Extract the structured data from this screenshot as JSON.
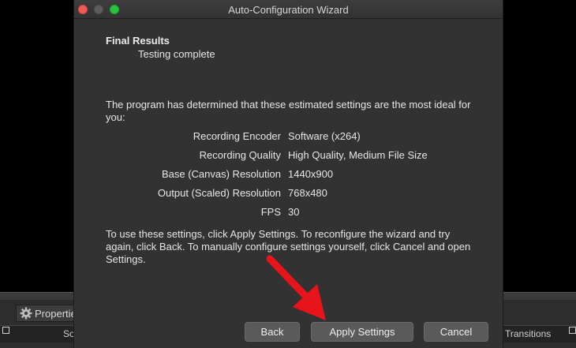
{
  "background_app": {
    "properties_label": "Properties",
    "left_dock_label": "So",
    "right_dock_label": "Transitions"
  },
  "dialog": {
    "title": "Auto-Configuration Wizard",
    "heading": "Final Results",
    "subheading": "Testing complete",
    "intro": "The program has determined that these estimated settings are the most ideal for you:",
    "settings": [
      {
        "label": "Recording Encoder",
        "value": "Software (x264)"
      },
      {
        "label": "Recording Quality",
        "value": "High Quality, Medium File Size"
      },
      {
        "label": "Base (Canvas) Resolution",
        "value": "1440x900"
      },
      {
        "label": "Output (Scaled) Resolution",
        "value": "768x480"
      },
      {
        "label": "FPS",
        "value": "30"
      }
    ],
    "outro": "To use these settings, click Apply Settings. To reconfigure the wizard and try again, click Back. To manually configure settings yourself, click Cancel and open Settings.",
    "buttons": {
      "back": "Back",
      "apply": "Apply Settings",
      "cancel": "Cancel"
    }
  },
  "colors": {
    "window_background": "#323232",
    "traffic_close": "#ee5b53",
    "traffic_max": "#29c13e",
    "annotation_arrow": "#e8141c"
  },
  "icons": [
    "gear-icon",
    "float-dock-icon",
    "annotation-arrow"
  ]
}
